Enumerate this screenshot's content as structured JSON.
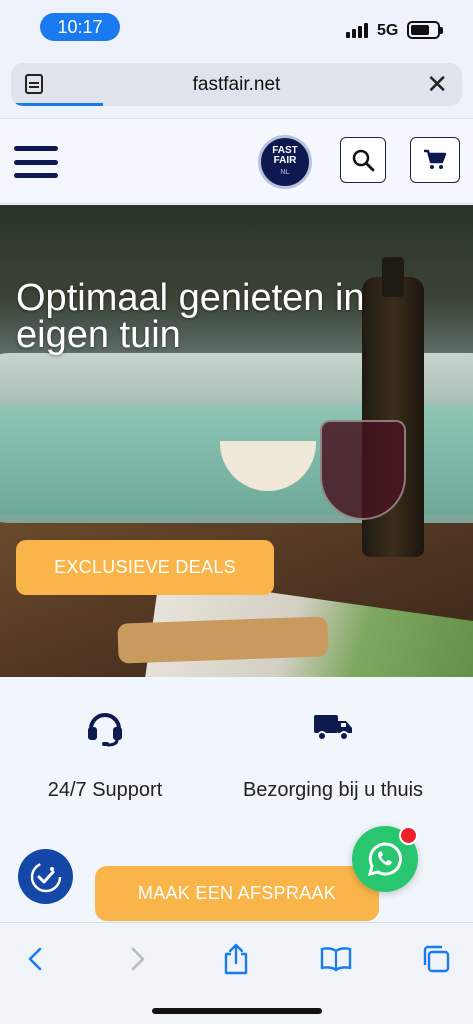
{
  "status_bar": {
    "time": "10:17",
    "network": "5G"
  },
  "browser": {
    "url": "fastfair.net"
  },
  "header": {
    "logo_line1": "FAST",
    "logo_line2": "FAIR",
    "logo_line3": "NL"
  },
  "hero": {
    "title": "Optimaal genieten in eigen tuin",
    "cta": "EXCLUSIEVE DEALS"
  },
  "features": [
    {
      "icon": "headset-icon",
      "label": "24/7 Support"
    },
    {
      "icon": "truck-icon",
      "label": "Bezorging bij u thuis"
    }
  ],
  "appointment": {
    "label": "MAAK EEN AFSPRAAK"
  },
  "colors": {
    "accent": "#f9b549",
    "brand": "#0e1a4f",
    "ios_blue": "#1a7bf0",
    "whatsapp": "#28c76f"
  },
  "toolbar_icons": [
    "back-icon",
    "forward-icon",
    "share-icon",
    "bookmarks-icon",
    "tabs-icon"
  ]
}
